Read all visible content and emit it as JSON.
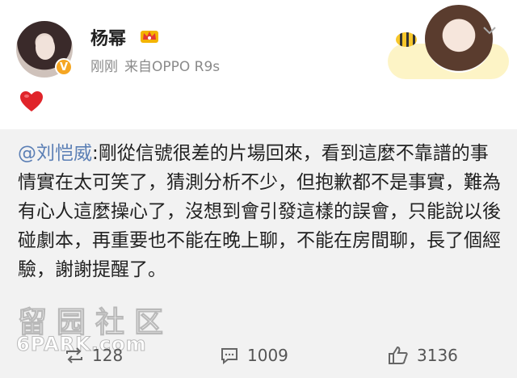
{
  "author": {
    "name": "杨幂",
    "verified_icon": "v-badge-icon",
    "level_icon": "crown-icon"
  },
  "meta": {
    "time": "刚刚",
    "source": "来自OPPO R9s"
  },
  "post": {
    "content_icon": "red-heart-icon"
  },
  "repost": {
    "mention": "@刘恺威",
    "text": ":剛從信號很差的片場回來，看到這麼不靠譜的事情實在太可笑了，猜測分析不少，但抱歉都不是事實，難為有心人這麼操心了，沒想到會引發這樣的誤會，只能說以後碰劇本，再重要也不能在晚上聊，不能在房間聊，長了個經驗，謝謝提醒了。"
  },
  "watermark": {
    "cn": "留园社区",
    "en": "6PARK.com"
  },
  "actions": {
    "repost_count": "128",
    "comment_count": "1009",
    "like_count": "3136"
  },
  "colors": {
    "mention": "#5b7fb5",
    "repost_bg": "#f2f2f2",
    "heart": "#e0242a",
    "badge": "#f5a623"
  }
}
